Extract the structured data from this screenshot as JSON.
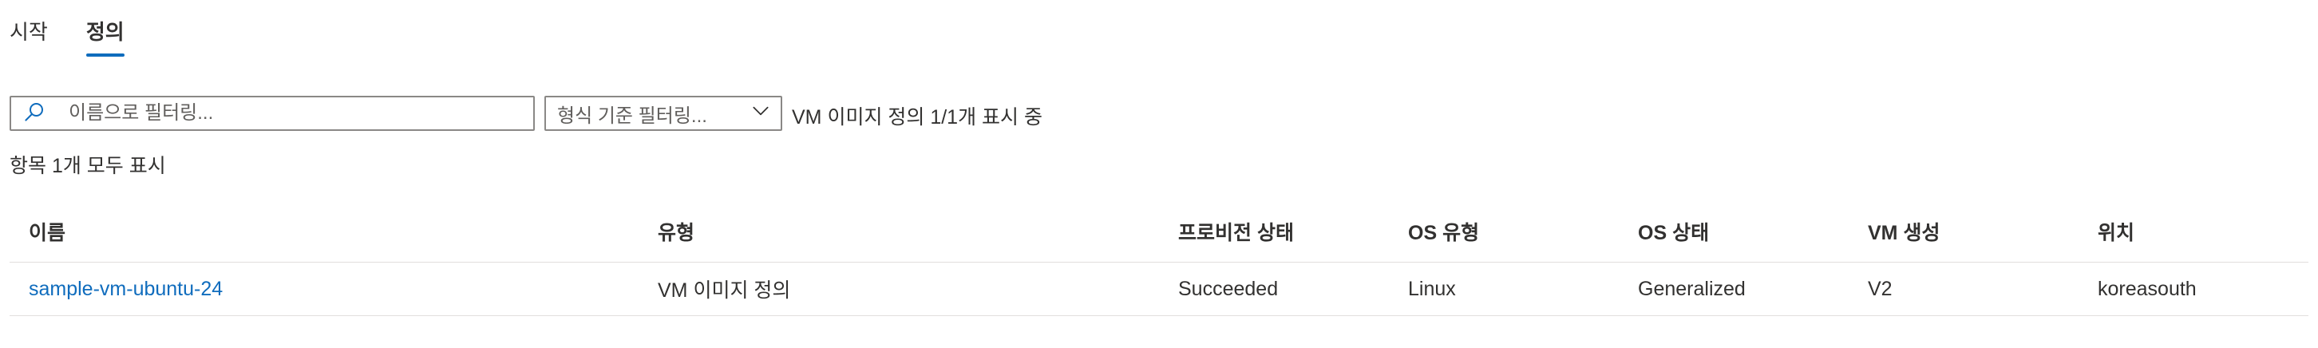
{
  "tabs": [
    {
      "label": "시작",
      "active": false
    },
    {
      "label": "정의",
      "active": true
    }
  ],
  "filters": {
    "search_placeholder": "이름으로 필터링...",
    "search_value": "",
    "type_filter_label": "형식 기준 필터링...",
    "count_text": "VM 이미지 정의 1/1개 표시 중"
  },
  "showing_all": "항목 1개 모두 표시",
  "table": {
    "columns": [
      "이름",
      "유형",
      "프로비전 상태",
      "OS 유형",
      "OS 상태",
      "VM 생성",
      "위치"
    ],
    "rows": [
      [
        "sample-vm-ubuntu-24",
        "VM 이미지 정의",
        "Succeeded",
        "Linux",
        "Generalized",
        "V2",
        "koreasouth"
      ]
    ]
  },
  "colors": {
    "accent": "#0f6cbd",
    "text": "#323130",
    "border": "#8a8886",
    "divider": "#e1dfdd"
  },
  "icons": {
    "search": "search-icon",
    "dropdown": "chevron-down-icon"
  }
}
